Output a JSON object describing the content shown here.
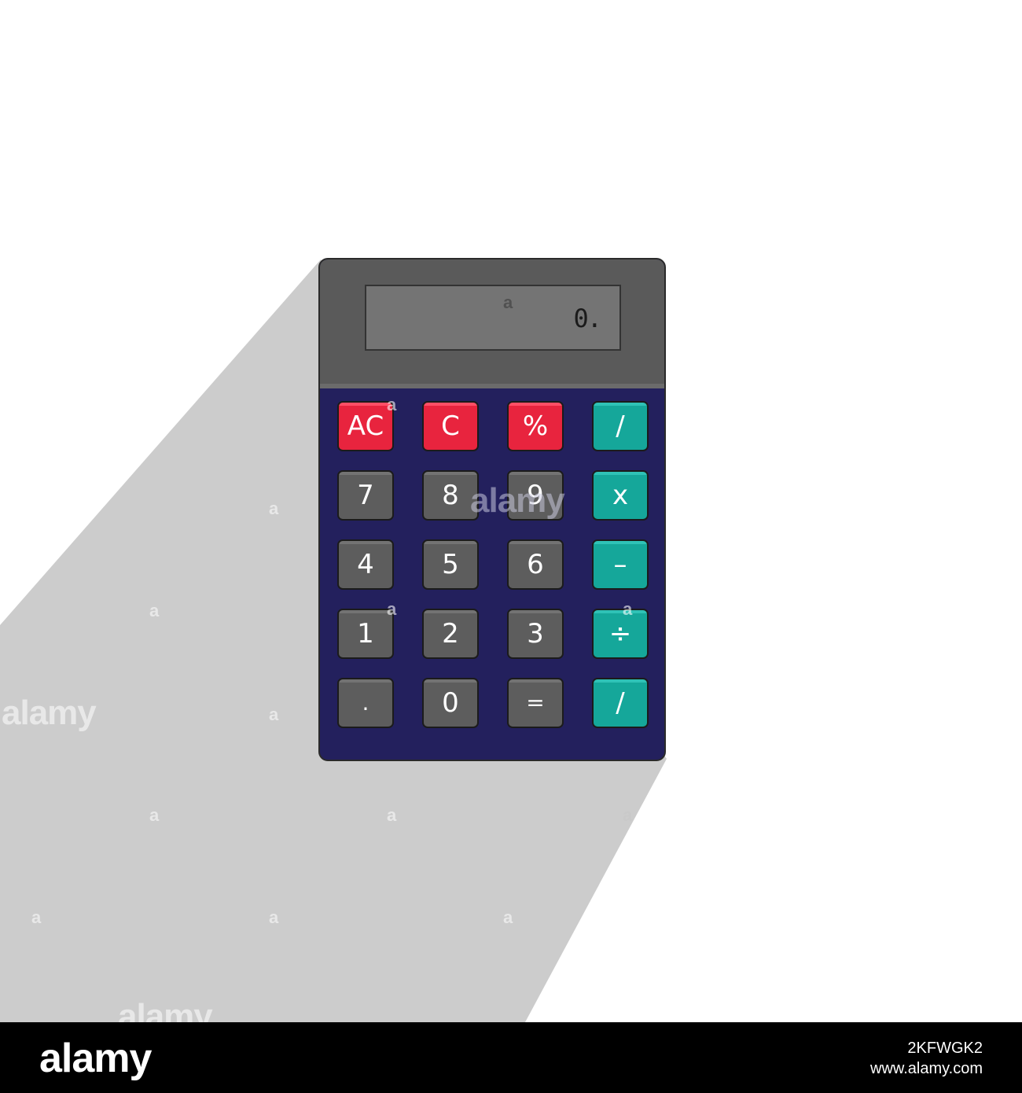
{
  "calculator": {
    "display_value": "0.",
    "keys": [
      {
        "label": "AC",
        "color": "red",
        "name": "all-clear-key"
      },
      {
        "label": "C",
        "color": "red",
        "name": "clear-key"
      },
      {
        "label": "%",
        "color": "red",
        "name": "percent-key"
      },
      {
        "label": "/",
        "color": "teal",
        "name": "slash-key-top"
      },
      {
        "label": "7",
        "color": "gray",
        "name": "digit-7-key"
      },
      {
        "label": "8",
        "color": "gray",
        "name": "digit-8-key"
      },
      {
        "label": "9",
        "color": "gray",
        "name": "digit-9-key"
      },
      {
        "label": "x",
        "color": "teal",
        "name": "multiply-key"
      },
      {
        "label": "4",
        "color": "gray",
        "name": "digit-4-key"
      },
      {
        "label": "5",
        "color": "gray",
        "name": "digit-5-key"
      },
      {
        "label": "6",
        "color": "gray",
        "name": "digit-6-key"
      },
      {
        "label": "–",
        "color": "teal",
        "name": "minus-key"
      },
      {
        "label": "1",
        "color": "gray",
        "name": "digit-1-key"
      },
      {
        "label": "2",
        "color": "gray",
        "name": "digit-2-key"
      },
      {
        "label": "3",
        "color": "gray",
        "name": "digit-3-key"
      },
      {
        "label": "÷",
        "color": "teal",
        "name": "divide-key"
      },
      {
        "label": ".",
        "color": "gray",
        "name": "decimal-point-key"
      },
      {
        "label": "0",
        "color": "gray",
        "name": "digit-0-key"
      },
      {
        "label": "=",
        "color": "gray",
        "name": "equals-key"
      },
      {
        "label": "/",
        "color": "teal",
        "name": "slash-key-bottom"
      }
    ]
  },
  "colors": {
    "body": "#23205d",
    "head": "#5a5a5a",
    "screen": "#747474",
    "key_gray": "#5d5d5d",
    "key_red": "#e8243e",
    "key_teal": "#15a79a",
    "shadow": "#cccccc"
  },
  "watermark": {
    "brand": "alamy",
    "small_mark": "a"
  },
  "footer": {
    "brand": "alamy",
    "image_id": "2KFWGK2",
    "site": "www.alamy.com"
  }
}
